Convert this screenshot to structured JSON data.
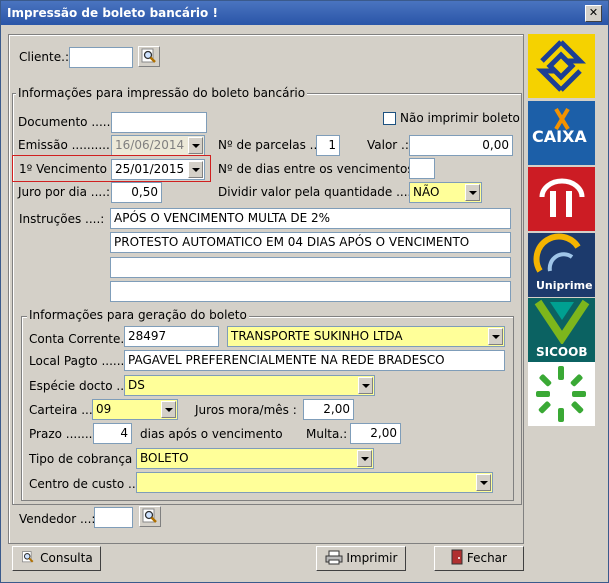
{
  "window": {
    "title": "Impressão de boleto bancário !",
    "close": "✕"
  },
  "cliente": {
    "label": "Cliente.:",
    "value": ""
  },
  "info": {
    "legend": "Informações para impressão do boleto bancário",
    "documento_label": "Documento .....:",
    "documento_value": "",
    "nao_imprimir_label": "Não imprimir boleto",
    "emissao_label": "Emissão ............:",
    "emissao_value": "16/06/2014",
    "parcelas_label": "Nº de parcelas ..:",
    "parcelas_value": "1",
    "valor_label": "Valor .:",
    "valor_value": "0,00",
    "vencimento_label": "1º Vencimento :",
    "vencimento_value": "25/01/2015",
    "dias_label": "Nº de dias entre os vencimentos :",
    "dias_value": "",
    "juro_label": "Juro por dia ....:",
    "juro_value": "0,50",
    "dividir_label": "Dividir valor pela quantidade ......:",
    "dividir_value": "NÃO",
    "instrucoes_label": "Instruções ....:",
    "instrucoes": [
      "APÓS O VENCIMENTO MULTA DE 2%",
      "PROTESTO AUTOMATICO EM 04 DIAS APÓS O VENCIMENTO",
      "",
      ""
    ]
  },
  "geracao": {
    "legend": "Informações para geração do boleto",
    "conta_label": "Conta Corrente.:",
    "conta_value": "28497",
    "conta_nome": "TRANSPORTE SUKINHO LTDA",
    "local_label": "Local Pagto .......:",
    "local_value": "PAGAVEL PREFERENCIALMENTE NA REDE BRADESCO",
    "especie_label": "Espécie docto ...:",
    "especie_value": "DS",
    "carteira_label": "Carteira ....:",
    "carteira_value": "09",
    "juros_label": "Juros mora/mês :",
    "juros_value": "2,00",
    "prazo_label": "Prazo .......:",
    "prazo_value": "4",
    "prazo_suffix": "dias após o vencimento",
    "multa_label": "Multa.:",
    "multa_value": "2,00",
    "tipo_label": "Tipo de cobrança :",
    "tipo_value": "BOLETO",
    "centro_label": "Centro de custo ...:",
    "centro_value": ""
  },
  "vendedor": {
    "label": "Vendedor ...:",
    "value": ""
  },
  "buttons": {
    "consulta": "Consulta",
    "imprimir": "Imprimir",
    "fechar": "Fechar"
  },
  "banks": {
    "caixa": "CAIXA",
    "uniprime": "Uniprime",
    "sicoob": "SICOOB"
  },
  "colors": {
    "yellow_field": "#ffff99",
    "highlight": "#d02020"
  }
}
